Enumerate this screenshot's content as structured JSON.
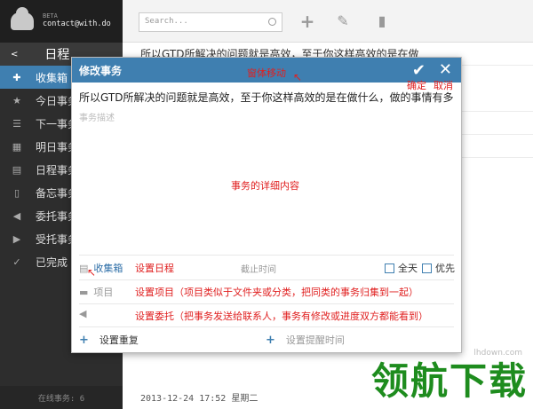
{
  "sidebar": {
    "beta": "BETA",
    "email": "contact@with.do",
    "header_arrow": "<",
    "header": "日程",
    "items": [
      {
        "label": "收集箱",
        "active": true
      },
      {
        "label": "今日事务"
      },
      {
        "label": "下一事务"
      },
      {
        "label": "明日事务"
      },
      {
        "label": "日程事务"
      },
      {
        "label": "备忘事务"
      },
      {
        "label": "委托事务"
      },
      {
        "label": "受托事务"
      },
      {
        "label": "已完成"
      }
    ],
    "footer": "在线事务: 6"
  },
  "toolbar": {
    "search_placeholder": "Search..."
  },
  "background": {
    "first_row": "所以GTD所解决的问题就是高效，至于你这样高效的是在做",
    "date": "2013-12-24 17:52 星期二"
  },
  "dialog": {
    "title": "修改事务",
    "task_title": "所以GTD所解决的问题就是高效，至于你这样高效的是在做什么，做的事情有多",
    "desc_placeholder": "事务描述",
    "folder": "收集箱",
    "deadline": "截止时间",
    "allday": "全天",
    "priority": "优先",
    "project": "项目",
    "repeat": "设置重复",
    "reminder": "设置提醒时间"
  },
  "annotations": {
    "drag": "窗体移动",
    "confirm": "确定",
    "cancel": "取消",
    "detail": "事务的详细内容",
    "schedule": "设置日程",
    "project": "设置项目（项目类似于文件夹或分类，把同类的事务归集到一起）",
    "delegate": "设置委托（把事务发送给联系人，事务有修改或进度双方都能看到）"
  },
  "watermark": {
    "text": "领航下载",
    "url": "lhdown.com"
  },
  "colors": {
    "accent": "#3f7fb0",
    "sidebar": "#2d2d2d",
    "annotation": "#e02020"
  }
}
